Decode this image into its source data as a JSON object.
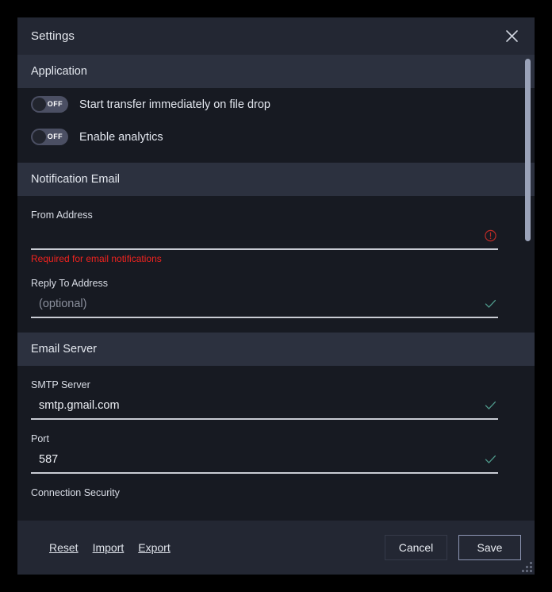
{
  "dialog": {
    "title": "Settings",
    "close_icon": "close-icon"
  },
  "sections": [
    {
      "name": "application",
      "header": "Application",
      "toggles": [
        {
          "name": "start-transfer-immediately",
          "label": "Start transfer immediately on file drop",
          "state": "OFF"
        },
        {
          "name": "enable-analytics",
          "label": "Enable analytics",
          "state": "OFF"
        }
      ]
    },
    {
      "name": "notification-email",
      "header": "Notification Email",
      "fields": [
        {
          "name": "from-address",
          "label": "From Address",
          "value": "",
          "placeholder": "",
          "status": "error",
          "status_icon": "error-circle-icon",
          "error": "Required for email notifications"
        },
        {
          "name": "reply-to-address",
          "label": "Reply To Address",
          "value": "",
          "placeholder": "(optional)",
          "status": "valid",
          "status_icon": "check-icon",
          "error": ""
        }
      ]
    },
    {
      "name": "email-server",
      "header": "Email Server",
      "fields": [
        {
          "name": "smtp-server",
          "label": "SMTP Server",
          "value": "smtp.gmail.com",
          "placeholder": "",
          "status": "valid",
          "status_icon": "check-icon",
          "error": ""
        },
        {
          "name": "port",
          "label": "Port",
          "value": "587",
          "placeholder": "",
          "status": "valid",
          "status_icon": "check-icon",
          "error": ""
        },
        {
          "name": "connection-security",
          "label": "Connection Security",
          "value": "",
          "placeholder": "",
          "status": "none",
          "status_icon": "",
          "error": ""
        }
      ]
    }
  ],
  "footer": {
    "reset_label": "Reset",
    "import_label": "Import",
    "export_label": "Export",
    "cancel_label": "Cancel",
    "save_label": "Save"
  },
  "colors": {
    "dialog_bg": "#1b1e27",
    "titlebar_bg": "#232733",
    "content_bg": "#171a22",
    "section_header_bg": "#2c313f",
    "error_red": "#f0231f",
    "valid_teal": "#4f9a8c",
    "toggle_track": "#4b4f63",
    "scrollbar_thumb": "#9aa2b8",
    "primary_border": "#8e97b5"
  }
}
